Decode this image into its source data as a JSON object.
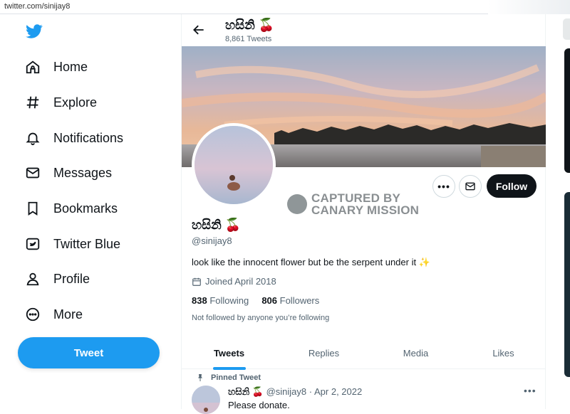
{
  "browser": {
    "url": "twitter.com/sinijay8"
  },
  "sidebar": {
    "logo_icon": "twitter-bird-icon",
    "items": [
      {
        "label": "Home",
        "icon": "home-icon"
      },
      {
        "label": "Explore",
        "icon": "hashtag-icon"
      },
      {
        "label": "Notifications",
        "icon": "bell-icon"
      },
      {
        "label": "Messages",
        "icon": "envelope-icon"
      },
      {
        "label": "Bookmarks",
        "icon": "bookmark-icon"
      },
      {
        "label": "Twitter Blue",
        "icon": "twitter-blue-icon"
      },
      {
        "label": "Profile",
        "icon": "person-icon"
      },
      {
        "label": "More",
        "icon": "more-circle-icon"
      }
    ],
    "tweet_button": "Tweet"
  },
  "header": {
    "name": "හසිනි 🍒",
    "tweet_count": "8,861 Tweets"
  },
  "profile": {
    "name": "හසිනි 🍒",
    "handle": "@sinijay8",
    "bio": "look like the innocent flower but be the serpent under it ✨",
    "joined": "Joined April 2018",
    "following_count": "838",
    "following_label": "Following",
    "followers_count": "806",
    "followers_label": "Followers",
    "not_followed": "Not followed by anyone you’re following",
    "follow_button": "Follow",
    "watermark_line1": "CAPTURED BY",
    "watermark_line2": "CANARY MISSION"
  },
  "tabs": [
    {
      "label": "Tweets",
      "active": true
    },
    {
      "label": "Replies",
      "active": false
    },
    {
      "label": "Media",
      "active": false
    },
    {
      "label": "Likes",
      "active": false
    }
  ],
  "pinned_tweet": {
    "pinned_label": "Pinned Tweet",
    "name": "හසිනි 🍒",
    "handle": "@sinijay8",
    "separator": "·",
    "date": "Apr 2, 2022",
    "text": "Please donate."
  },
  "colors": {
    "accent": "#1d9bf0",
    "text": "#0f1419",
    "muted": "#536471",
    "follow_bg": "#0f1419"
  }
}
